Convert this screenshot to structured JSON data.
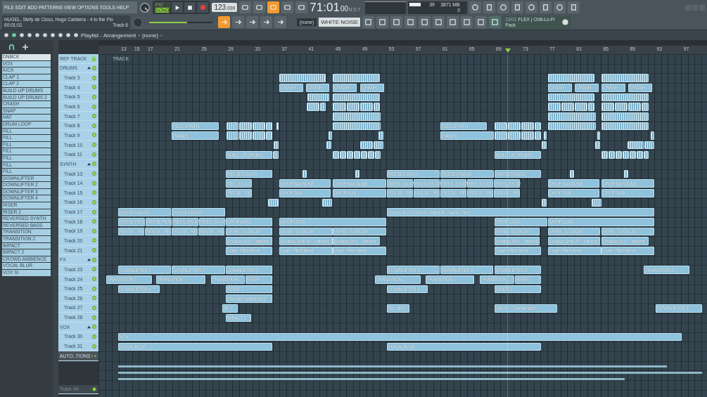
{
  "menu": [
    "FILE",
    "EDIT",
    "ADD",
    "PATTERNS",
    "VIEW",
    "OPTIONS",
    "TOOLS",
    "HELP"
  ],
  "song": {
    "title": "HUGEL, Stefy de Cicco, Hugo Cantarra - 4 to the Flo",
    "time": "60:01:01",
    "track": "Track 6"
  },
  "mode": [
    {
      "label": "PAT",
      "selected": false
    },
    {
      "label": "SONG",
      "selected": true
    }
  ],
  "tempo": {
    "main": "123",
    "fraction": ".000"
  },
  "clock": {
    "main": "71:01",
    "sub": "00",
    "unit": "B:S:T"
  },
  "cpu": {
    "voices": "39",
    "memory": "3871 MB",
    "polyphony": "0"
  },
  "master_volume": {
    "level": 0.6
  },
  "pattern_select": "(none)",
  "channel": "WHITE NOISE",
  "news": {
    "date": "13/01",
    "title": "FLEX | Chill-Lo-Fi",
    "subtitle": "Pack"
  },
  "toolbar": {
    "title": "Playlist - Arrangement",
    "separator": "›",
    "pattern": "(none)",
    "end": "›"
  },
  "browser": {
    "items": [
      {
        "name": "DNBCK",
        "selected": true
      },
      {
        "name": "VOX",
        "selected": false
      },
      {
        "name": "KICK",
        "selected": false
      },
      {
        "name": "CLAP 1",
        "selected": false
      },
      {
        "name": "CLAP 2",
        "selected": false
      },
      {
        "name": "BUILD UP DRUMS",
        "selected": false
      },
      {
        "name": "BUILD UP DRUMS 2",
        "selected": false
      },
      {
        "name": "CRASH",
        "selected": false
      },
      {
        "name": "SNAP",
        "selected": false
      },
      {
        "name": "HAT",
        "selected": false
      },
      {
        "name": "DRUM LOOP",
        "selected": false
      },
      {
        "name": "FILL",
        "selected": false
      },
      {
        "name": "FILL",
        "selected": false
      },
      {
        "name": "FILL",
        "selected": false
      },
      {
        "name": "FILL",
        "selected": false
      },
      {
        "name": "FILL",
        "selected": false
      },
      {
        "name": "FILL",
        "selected": false
      },
      {
        "name": "FILL",
        "selected": false
      },
      {
        "name": "DOWNLIFTER",
        "selected": false
      },
      {
        "name": "DOWNLIFTER 2",
        "selected": false
      },
      {
        "name": "DOWNLIFTER 3",
        "selected": false
      },
      {
        "name": "DOWNLIFTER 4",
        "selected": false
      },
      {
        "name": "RISER",
        "selected": false
      },
      {
        "name": "RISER 2",
        "selected": false
      },
      {
        "name": "REVERSED SYNTH",
        "selected": false
      },
      {
        "name": "REVERSED BASS",
        "selected": false
      },
      {
        "name": "TRANSITION",
        "selected": false
      },
      {
        "name": "TRANSITION 2",
        "selected": false
      },
      {
        "name": "IMPACT",
        "selected": false
      },
      {
        "name": "IMPACT 2",
        "selected": false
      },
      {
        "name": "CROWD AMBIENCE",
        "selected": false
      },
      {
        "name": "VOCAL BLUR",
        "selected": false
      },
      {
        "name": "VOX SI",
        "selected": false
      }
    ]
  },
  "ruler": [
    "13",
    "15",
    "17",
    "21",
    "25",
    "29",
    "33",
    "37",
    "41",
    "45",
    "49",
    "53",
    "57",
    "61",
    "65",
    "69",
    "73",
    "77",
    "81",
    "85",
    "89",
    "93",
    "97"
  ],
  "playlist_header": "TRACK",
  "tracks": [
    {
      "name": "REF TRACK",
      "kind": "ref"
    },
    {
      "name": "DRUMS",
      "kind": "group"
    },
    {
      "name": "Track 3",
      "kind": "track"
    },
    {
      "name": "Track 4",
      "kind": "track",
      "clips": [
        "CRASH",
        "CRASH",
        "CRASH",
        "CRASH",
        "CRASH",
        "CRASH",
        "CRASH",
        "CRASH"
      ]
    },
    {
      "name": "Track 5",
      "kind": "track"
    },
    {
      "name": "Track 6",
      "kind": "track"
    },
    {
      "name": "Track 7",
      "kind": "track"
    },
    {
      "name": "Track 8",
      "kind": "track",
      "clips": [
        "FLEX SYNTH",
        "FLEX SYNTH"
      ]
    },
    {
      "name": "Track 9",
      "kind": "track",
      "clips": [
        "PIANOS",
        "PIANOS"
      ]
    },
    {
      "name": "Track 10",
      "kind": "track"
    },
    {
      "name": "Track 11",
      "kind": "track",
      "clips": [
        "BUILD UP DRUMS",
        "BUILD UP DRUMS"
      ]
    },
    {
      "name": "SYNTH",
      "kind": "group"
    },
    {
      "name": "Track 13",
      "kind": "track",
      "clips": [
        "REESES BASS",
        "REESES BASS",
        "REESES BASS",
        "REESES BASS"
      ]
    },
    {
      "name": "Track 14",
      "kind": "track",
      "clips": [
        "REE..EN #2",
        "DROP BASSLINE",
        "DROP BASSLINE",
        "REES..EN #2",
        "REES..EN #2",
        "REES..EN #2",
        "REE..EN #2",
        "REES..EN #2",
        "DROP BASSLINE",
        "DROP BASSLINE"
      ]
    },
    {
      "name": "Track 15",
      "kind": "track",
      "clips": [
        "REESE - RE",
        "DROP SUB",
        "DROP SUB",
        "REESE - RE",
        "REESE - RE",
        "REESE - RE",
        "REESE - RE",
        "REESE - RE",
        "DROP SUB",
        "DROP SUB"
      ]
    },
    {
      "name": "Track 16",
      "kind": "track"
    },
    {
      "name": "Track 17",
      "kind": "track",
      "clips": [
        "REESES BASS",
        "REESES BASS",
        "Param. EQ 2 (Slot 9) - Insert 50 - Band 7 freq"
      ]
    },
    {
      "name": "Track 18",
      "kind": "track",
      "clips": [
        "REESE PEN",
        "REESE PEN",
        "REES..EN #2",
        "REES..EN #2",
        "DROP LEAD",
        "DROP LEAD",
        "DROP LEAD",
        "DROP LEAD"
      ]
    },
    {
      "name": "Track 19",
      "kind": "track",
      "clips": [
        "REESE - RE",
        "REESE - RE",
        "REESE - RE",
        "REESE - RE",
        "VERB - To DELAY",
        "VERB - To DELAY",
        "VERB - To DELAY",
        "VERB - To DELAY",
        "VERB - To DELAY",
        "VERB - To DELAY"
      ]
    },
    {
      "name": "Track 20",
      "kind": "track",
      "clips": [
        "Endless Smi.. - Interest",
        "Endless Smil..AY - Interest",
        "Endless Smi.. - Interest",
        "Endless Smi.. - Interest",
        "Endless Smil..AY - Interest",
        "Endless Smi.. - Interest"
      ]
    },
    {
      "name": "Track 21",
      "kind": "track",
      "clips": [
        "Lead - Pitch Bend",
        "Lead - Pitch Bend",
        "Lead - Pitch Bend",
        "Lead - Pitch Bend",
        "Lead - Pitch Bend",
        "Lead - Pitch Bend"
      ]
    },
    {
      "name": "FX",
      "kind": "group"
    },
    {
      "name": "Track 23",
      "kind": "track",
      "clips": [
        "DOWNLIFTER 2",
        "DOWNLIFTER 2",
        "DOWNLIFTER 2",
        "DOWNLIFTER 2",
        "DOWNLIFTER 2",
        "DOWNLIFTER 2",
        "TRANSITION 2"
      ]
    },
    {
      "name": "Track 24",
      "kind": "track",
      "clips": [
        "TRANSITION 2",
        "TRANSITION",
        "TRANSITION",
        "RISER",
        "TRANSITION 2",
        "TRANSITION",
        "TRANSITION",
        "RISER"
      ]
    },
    {
      "name": "Track 25",
      "kind": "track",
      "clips": [
        "DOWNLIFTER 4",
        "RISER 2",
        "DOWNLIFTER 4",
        "RISER 2"
      ]
    },
    {
      "name": "Track 26",
      "kind": "track",
      "clips": [
        "CROWD AMBIENCE"
      ]
    },
    {
      "name": "Track 27",
      "kind": "track",
      "clips": [
        "IM..T",
        "Ser..pitch",
        "Serum - Channel pitch",
        "DOWNLIFTER 3"
      ]
    },
    {
      "name": "Track 28",
      "kind": "track",
      "clips": [
        "IMPACT 2"
      ]
    },
    {
      "name": "VOX",
      "kind": "group"
    },
    {
      "name": "Track 30",
      "kind": "track",
      "clips": [
        "VOX"
      ]
    },
    {
      "name": "Track 31",
      "kind": "track",
      "clips": [
        "VOCAL BLUR",
        "VOCAL BLUR"
      ]
    },
    {
      "name": "AUTO..TIONS",
      "kind": "automation"
    },
    {
      "name": "Track 44",
      "kind": "inactive"
    }
  ]
}
